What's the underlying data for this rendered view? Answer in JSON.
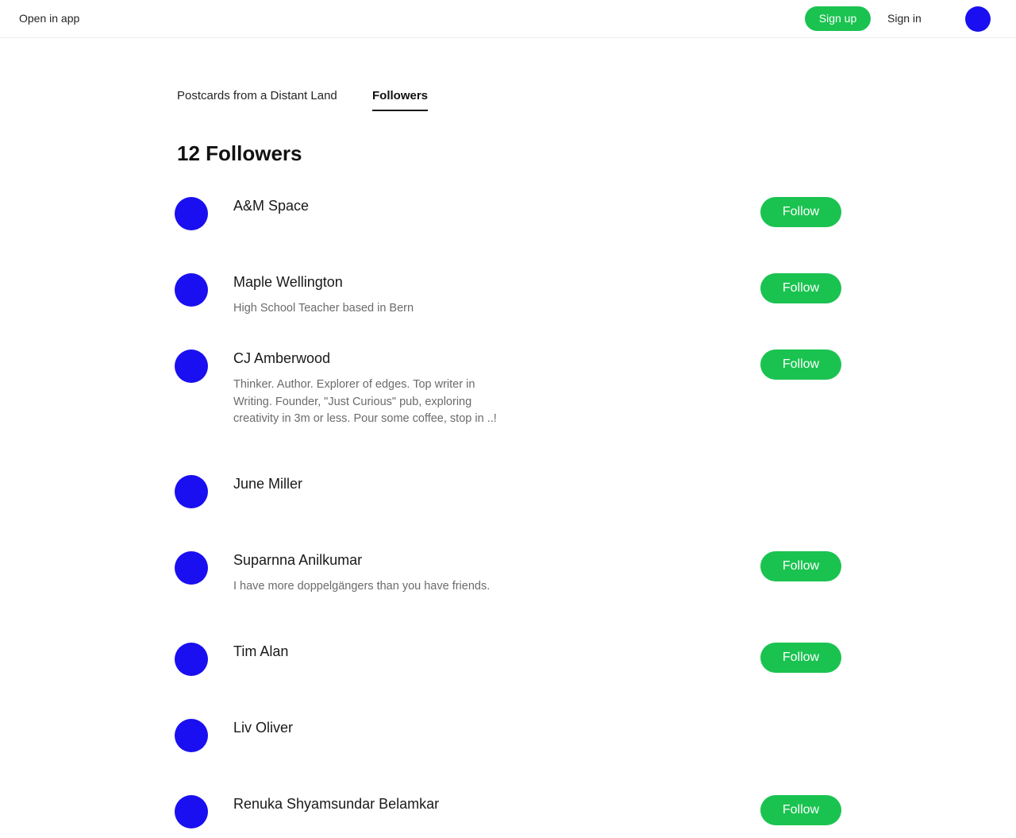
{
  "header": {
    "open_in_app": "Open in app",
    "sign_up": "Sign up",
    "sign_in": "Sign in"
  },
  "tabs": [
    {
      "label": "Postcards from a Distant Land",
      "active": false
    },
    {
      "label": "Followers",
      "active": true
    }
  ],
  "page_title": "12 Followers",
  "followers": [
    {
      "name": "A&M Space",
      "bio": "",
      "follow_label": "Follow"
    },
    {
      "name": "Maple Wellington",
      "bio": "High School Teacher based in Bern",
      "follow_label": "Follow"
    },
    {
      "name": "CJ Amberwood",
      "bio": "Thinker. Author. Explorer of edges. Top writer in Writing. Founder, \"Just Curious\" pub, exploring creativity in 3m or less. Pour some coffee, stop in ..!",
      "follow_label": "Follow"
    },
    {
      "name": "June Miller",
      "bio": "",
      "follow_label": ""
    },
    {
      "name": "Suparnna Anilkumar",
      "bio": "I have more doppelgängers than you have friends.",
      "follow_label": "Follow"
    },
    {
      "name": "Tim Alan",
      "bio": "",
      "follow_label": "Follow"
    },
    {
      "name": "Liv Oliver",
      "bio": "",
      "follow_label": ""
    },
    {
      "name": "Renuka Shyamsundar Belamkar",
      "bio": "",
      "follow_label": "Follow"
    }
  ],
  "colors": {
    "accent_green": "#1ac350",
    "avatar_blue": "#1a0ff0"
  }
}
